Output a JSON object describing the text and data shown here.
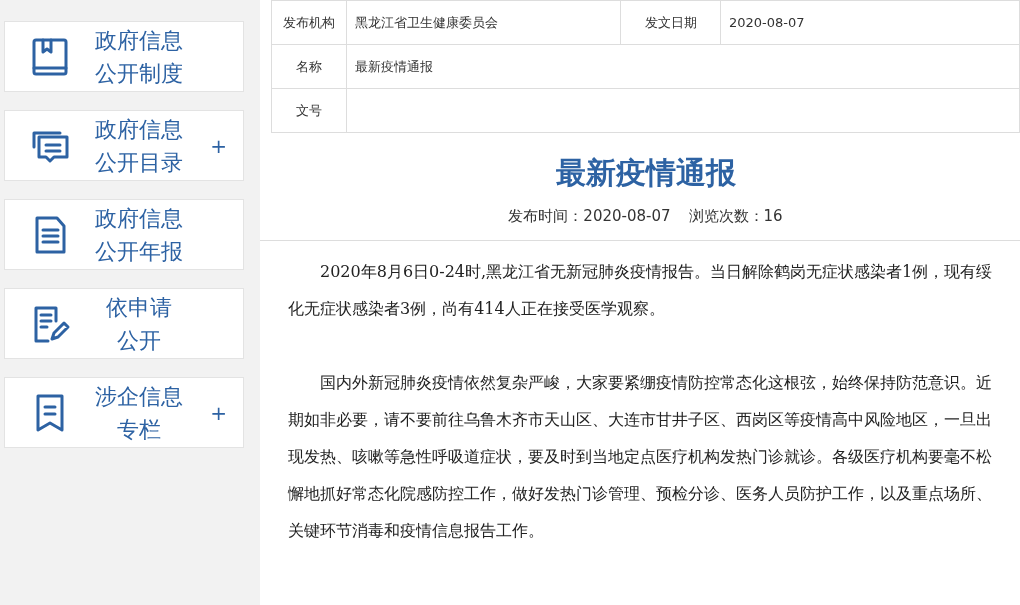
{
  "sidebar": {
    "items": [
      {
        "kind": "book",
        "lines": [
          "政府信息",
          "公开制度"
        ]
      },
      {
        "kind": "chat",
        "lines": [
          "政府信息",
          "公开目录"
        ],
        "expand_mark": "+"
      },
      {
        "kind": "document",
        "lines": [
          "政府信息",
          "公开年报"
        ]
      },
      {
        "kind": "edit",
        "lines": [
          "依申请",
          "公开"
        ]
      },
      {
        "kind": "bookmark",
        "lines": [
          "涉企信息",
          "专栏"
        ],
        "expand_mark": "+"
      }
    ]
  },
  "info_table": {
    "rows": [
      [
        {
          "label": "发布机构",
          "value": "黑龙江省卫生健康委员会"
        },
        {
          "label": "发文日期",
          "value": "2020-08-07"
        }
      ],
      [
        {
          "label": "名称",
          "value": "最新疫情通报"
        }
      ],
      [
        {
          "label": "文号"
        }
      ]
    ]
  },
  "article": {
    "title": "最新疫情通报",
    "meta": [
      "发布时间：2020-08-07",
      "浏览次数：16"
    ],
    "paragraphs": [
      "2020年8月6日0-24时,黑龙江省无新冠肺炎疫情报告。当日解除鹤岗无症状感染者1例，现有绥化无症状感染者3例，尚有414人正在接受医学观察。",
      "国内外新冠肺炎疫情依然复杂严峻，大家要紧绷疫情防控常态化这根弦，始终保持防范意识。近期如非必要，请不要前往乌鲁木齐市天山区、大连市甘井子区、西岗区等疫情高中风险地区，一旦出现发热、咳嗽等急性呼吸道症状，要及时到当地定点医疗机构发热门诊就诊。各级医疗机构要毫不松懈地抓好常态化院感防控工作，做好发热门诊管理、预检分诊、医务人员防护工作，以及重点场所、关键环节消毒和疫情信息报告工作。"
    ]
  }
}
